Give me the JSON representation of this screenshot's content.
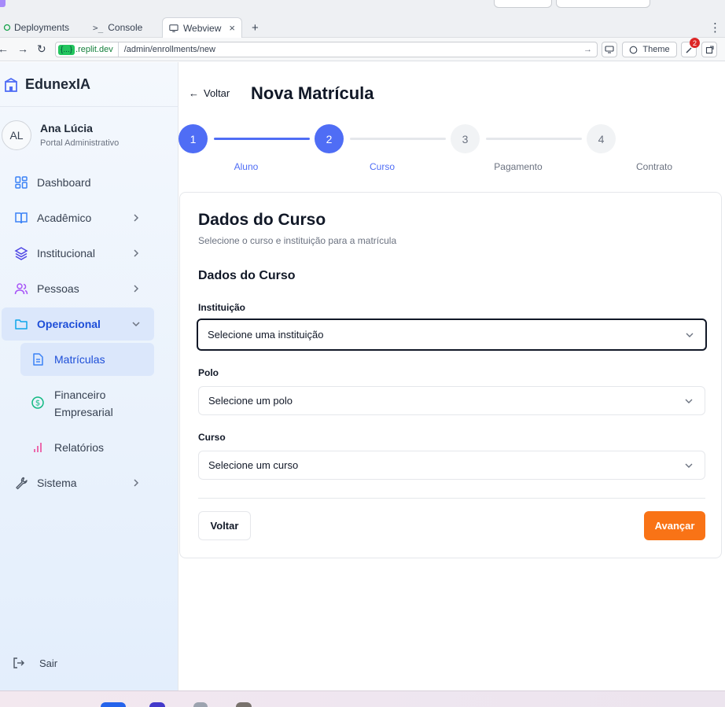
{
  "browser": {
    "tabs": [
      {
        "label": "Deployments",
        "icon": "deployments-icon"
      },
      {
        "label": "Console",
        "icon": "terminal-icon"
      },
      {
        "label": "Webview",
        "icon": "monitor-icon",
        "close": "×"
      }
    ],
    "new_tab": "+",
    "menu": "⋮",
    "url_badge": "{...}",
    "url_host": ".replit.dev",
    "url_path": "/admin/enrollments/new",
    "theme_label": "Theme",
    "notification_count": "2"
  },
  "sidebar": {
    "brand": "EdunexIA",
    "user": {
      "initials": "AL",
      "name": "Ana Lúcia",
      "role": "Portal Administrativo"
    },
    "items": [
      {
        "label": "Dashboard",
        "icon": "dashboard-grid-icon"
      },
      {
        "label": "Acadêmico",
        "icon": "book-open-icon"
      },
      {
        "label": "Institucional",
        "icon": "layers-icon"
      },
      {
        "label": "Pessoas",
        "icon": "users-icon"
      },
      {
        "label": "Operacional",
        "icon": "folder-icon"
      },
      {
        "label": "Sistema",
        "icon": "wrench-icon"
      }
    ],
    "subitems": [
      {
        "label": "Matrículas",
        "icon": "file-text-icon"
      },
      {
        "label": "Financeiro Empresarial",
        "icon": "dollar-circle-icon"
      },
      {
        "label": "Relatórios",
        "icon": "bar-chart-icon"
      }
    ],
    "logout": "Sair"
  },
  "main": {
    "back_label": "Voltar",
    "title": "Nova Matrícula",
    "steps": [
      {
        "number": "1",
        "label": "Aluno"
      },
      {
        "number": "2",
        "label": "Curso"
      },
      {
        "number": "3",
        "label": "Pagamento"
      },
      {
        "number": "4",
        "label": "Contrato"
      }
    ],
    "current_step": 2,
    "card": {
      "title": "Dados do Curso",
      "subtitle": "Selecione o curso e instituição para a matrícula",
      "section_title": "Dados do Curso",
      "fields": [
        {
          "label": "Instituição",
          "placeholder": "Selecione uma instituição"
        },
        {
          "label": "Polo",
          "placeholder": "Selecione um polo"
        },
        {
          "label": "Curso",
          "placeholder": "Selecione um curso"
        }
      ],
      "back_button": "Voltar",
      "next_button": "Avançar"
    }
  },
  "colors": {
    "primary": "#4f6df5",
    "accent": "#f97316",
    "active_nav_bg": "#dbe7fb",
    "active_nav_text": "#1d4ed8"
  }
}
